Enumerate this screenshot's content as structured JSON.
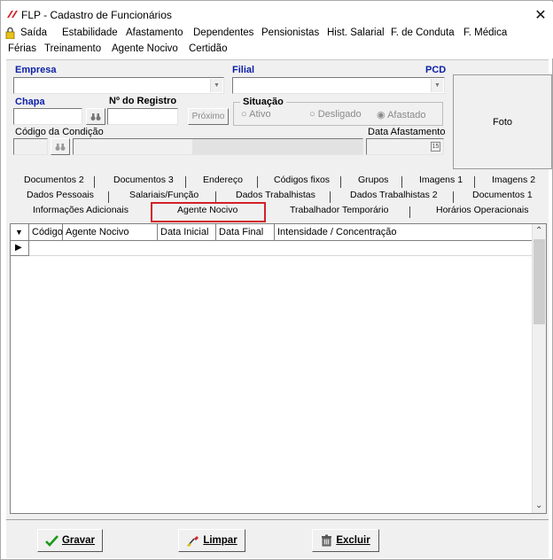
{
  "window": {
    "title": "FLP - Cadastro de Funcionários",
    "close_glyph": "✕",
    "accent_color": "#d4202a"
  },
  "menu": {
    "row1": [
      "Saída",
      "Estabilidade",
      "Afastamento",
      "Dependentes",
      "Pensionistas",
      "Hist. Salarial",
      "F. de Conduta",
      "F. Médica"
    ],
    "row2": [
      "Férias",
      "Treinamento",
      "Agente Nocivo",
      "Certidão"
    ]
  },
  "form": {
    "empresa_label": "Empresa",
    "filial_label": "Filial",
    "pcd_label": "PCD",
    "chapa_label": "Chapa",
    "registro_label": "Nº do Registro",
    "proximo_label": "Próximo",
    "situacao_label": "Situação",
    "situacao_options": [
      "Ativo",
      "Desligado",
      "Afastado"
    ],
    "situacao_selected": "Afastado",
    "codigo_condicao_label": "Código da Condição",
    "data_afastamento_label": "Data Afastamento",
    "foto_label": "Foto"
  },
  "tabs": {
    "row1": [
      "Documentos 2",
      "Documentos 3",
      "Endereço",
      "Códigos fixos",
      "Grupos",
      "Imagens 1",
      "Imagens 2"
    ],
    "row2": [
      "Dados Pessoais",
      "Salariais/Função",
      "Dados Trabalhistas",
      "Dados Trabalhistas 2",
      "Documentos 1"
    ],
    "row3": [
      "Informações Adicionais",
      "Agente Nocivo",
      "Trabalhador Temporário",
      "Horários Operacionais"
    ],
    "active": "Agente Nocivo"
  },
  "grid": {
    "columns": [
      "Código",
      "Agente Nocivo",
      "Data Inicial",
      "Data Final",
      "Intensidade /  Concentração"
    ],
    "rows": []
  },
  "actions": {
    "gravar": "Gravar",
    "limpar": "Limpar",
    "excluir": "Excluir"
  }
}
